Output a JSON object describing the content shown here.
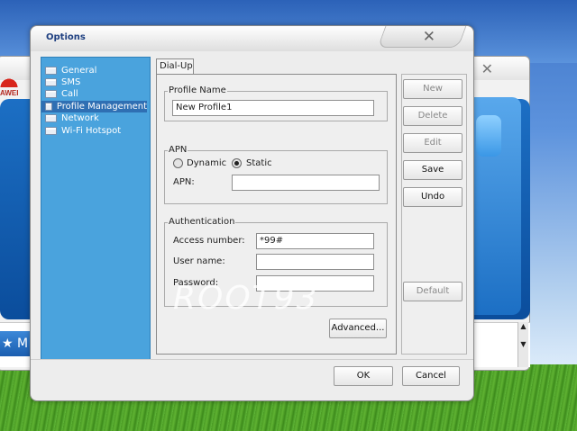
{
  "background": {
    "logo_text": "AWEI",
    "home_label": "M"
  },
  "dialog": {
    "title": "Options",
    "close_glyph": "✕",
    "nav": [
      {
        "label": "General"
      },
      {
        "label": "SMS"
      },
      {
        "label": "Call"
      },
      {
        "label": "Profile Management",
        "selected": true
      },
      {
        "label": "Network"
      },
      {
        "label": "Wi-Fi Hotspot"
      }
    ],
    "tab": "Dial-Up",
    "profile_name": {
      "group_label": "Profile Name",
      "value": "New Profile1"
    },
    "apn": {
      "group_label": "APN",
      "radio_dynamic": "Dynamic",
      "radio_static": "Static",
      "selected": "Static",
      "field_label": "APN:",
      "value": ""
    },
    "authentication": {
      "group_label": "Authentication",
      "access_number_label": "Access number:",
      "access_number_value": "*99#",
      "user_name_label": "User name:",
      "user_name_value": "",
      "password_label": "Password:",
      "password_value": ""
    },
    "buttons": {
      "new": "New",
      "delete": "Delete",
      "edit": "Edit",
      "save": "Save",
      "undo": "Undo",
      "default": "Default",
      "advanced": "Advanced...",
      "ok": "OK",
      "cancel": "Cancel"
    },
    "watermark": "ROOT93"
  },
  "colors": {
    "nav_bg": "#4aa3dd",
    "nav_selected": "#2f6fb3",
    "title_text": "#1e3f80"
  }
}
